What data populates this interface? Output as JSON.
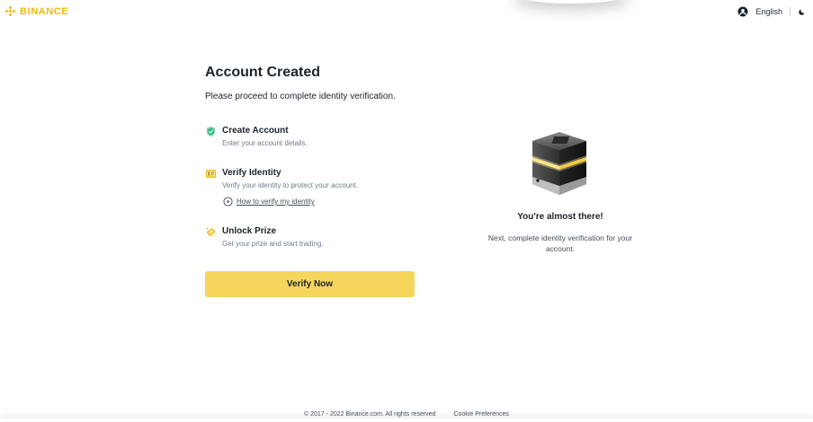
{
  "header": {
    "logo_text": "BINANCE",
    "language": "English",
    "brand_color": "#F0B90B",
    "icons": [
      "binance-logo-icon",
      "user-avatar-icon",
      "moon-icon"
    ]
  },
  "main": {
    "title": "Account Created",
    "subtitle": "Please proceed to complete identity verification.",
    "steps": [
      {
        "icon": "check-circle-icon",
        "title": "Create Account",
        "description": "Enter your account details.",
        "status": "completed"
      },
      {
        "icon": "id-card-icon",
        "title": "Verify Identity",
        "description": "Verify your identity to protect your account.",
        "link_icon": "play-circle-icon",
        "link": "How to verify my identity"
      },
      {
        "icon": "prize-ticket-icon",
        "title": "Unlock Prize",
        "description": "Get your prize and start trading."
      }
    ],
    "verify_button": "Verify Now",
    "button_color": "#F6D55C"
  },
  "side_panel": {
    "illustration": "glowing-box-illustration",
    "title": "You're almost there!",
    "description": "Next, complete identity verification for your account."
  },
  "footer": {
    "copyright": "© 2017 - 2022 Binance.com. All rights reserved",
    "cookie_link": "Cookie Preferences"
  }
}
